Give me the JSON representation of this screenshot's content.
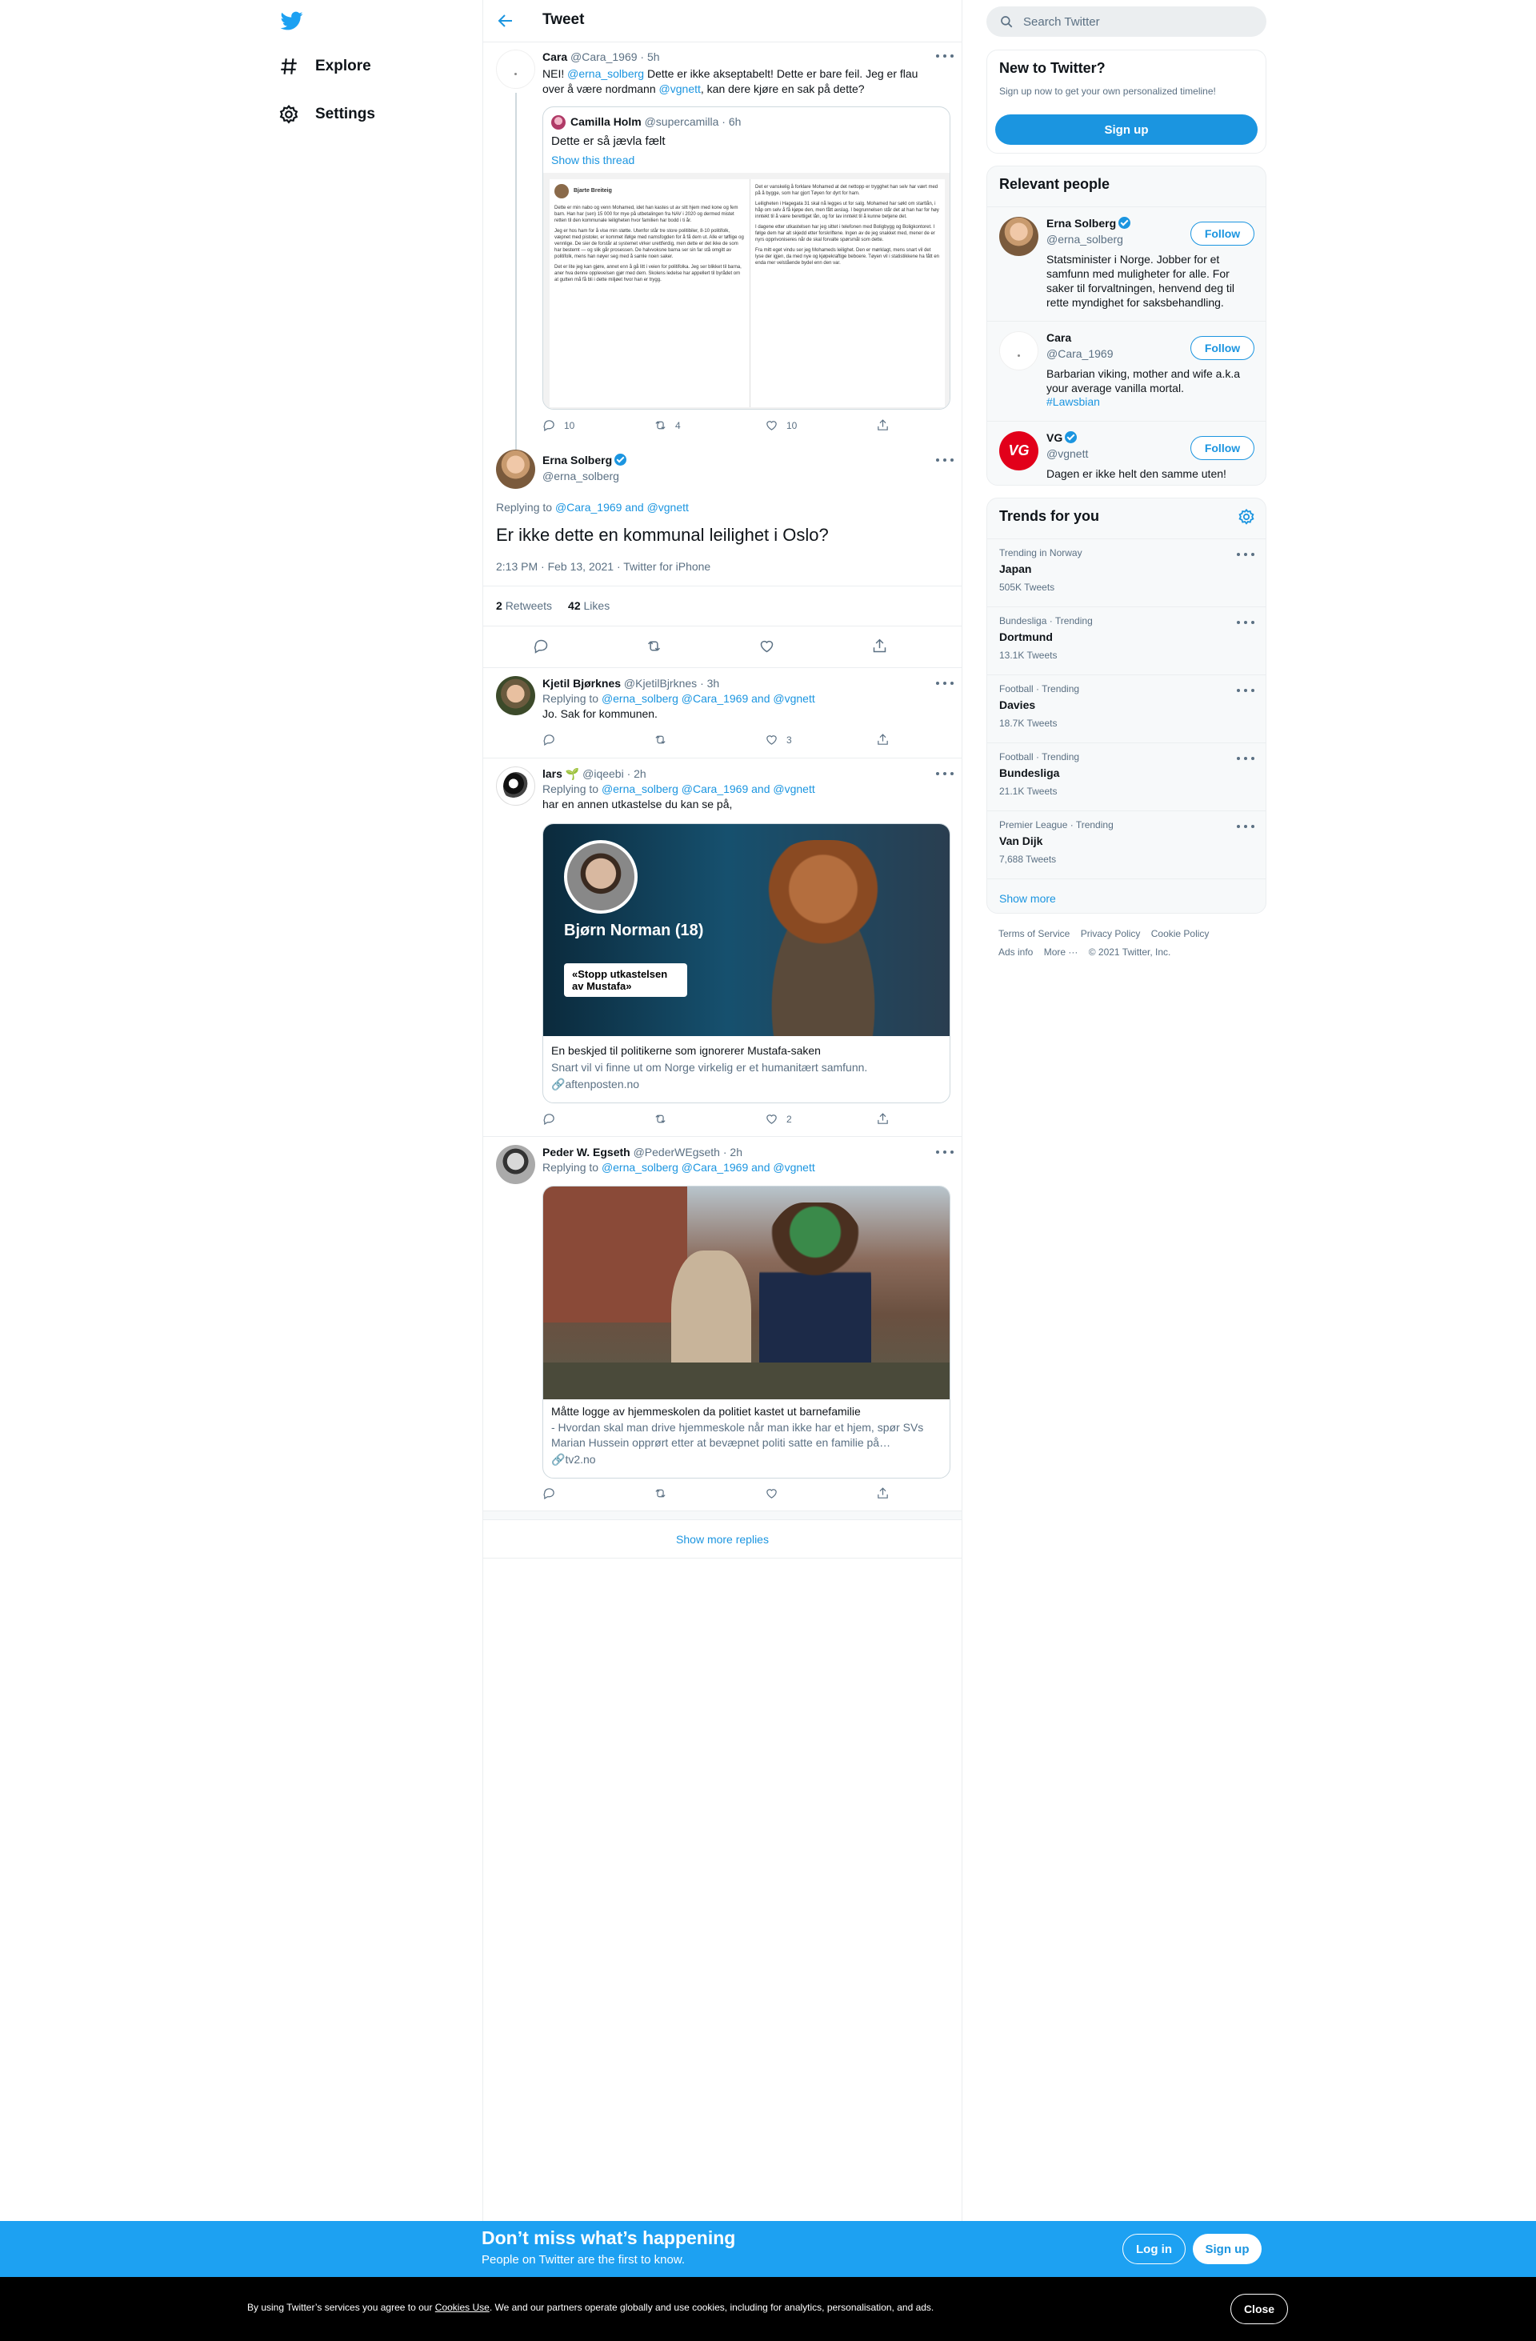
{
  "nav": {
    "explore_label": "Explore",
    "settings_label": "Settings"
  },
  "header": {
    "title": "Tweet"
  },
  "parent_tweet": {
    "name": "Cara",
    "handle": "@Cara_1969",
    "time": "· 5h",
    "text_before": "NEI! ",
    "mention1": "@erna_solberg",
    "text_middle": " Dette er ikke akseptabelt! Dette er bare feil. Jeg er flau over å være nordmann ",
    "mention2": "@vgnett",
    "text_after": ", kan dere kjøre en sak på dette?",
    "quoted": {
      "name": "Camilla Holm",
      "handle": "@supercamilla",
      "time": "· 6h",
      "text": "Dette er så jævla fælt",
      "show_thread": "Show this thread",
      "doc_author": "Bjarte Breiteig",
      "doc_left": [
        "Dette er min nabo og venn Mohamed, idet han kastes ut av sitt hjem med kone og fem barn. Han har (sen) 15 000 for mye på utbetalingen fra NAV i 2020 og dermed mistet retten til den kommunale leiligheten hvor familien har bodd i ti år.",
        "Jeg er hos ham for å vise min støtte. Utenfor står tre store politibiler, 8-10 politifolk, væpnet med pistoler, er kommet ifølge med namsfogden for å få dem ut. Alle er tøflige og vennlige. De sier de forstår at systemet virker urettferdig, men dette er det ikke de som har bestemt — og slik går prosessen. De halvvoksne barna ser sin far stå omgitt av politifolk, mens han nøyer seg med å samle noen saker.",
        "Det er lite jeg kan gjøre, annet enn å gå litt i veien for politifolka. Jeg ser blikket til barna, aner hva denne opplevelsen gjør med dem. Skolens ledelse har appellert til byrådet om at gutten må få bli i dette miljøet hvor han er trygg."
      ],
      "doc_right": [
        "Det er vanskelig å forklare Mohamed at det nettopp er trygghet han selv har vært med på å bygge, som har gjort Tøyen for dyrt for ham.",
        "Leiligheten i Hagegata 31 skal nå legges ut for salg. Mohamed har søkt om startlån, i håp om selv å få kjøpe den, men fått avslag. I begrunnelsen står det at han har for høy inntekt til å være berettiget lån, og for lav inntekt til å kunne betjene det.",
        "I dagene etter utkastelsen har jeg sittet i telefonen med Boligbygg og Boligkontoret. I følge dem har alt skjedd etter forskriftene. Ingen av de jeg snakket med, mener de er nyrs opprivoniseres når de skal forvalte spørsmål som dette.",
        "Fra mitt eget vindu ser jeg Mohameds leilighet. Den er mørklagt, mens snart vil det lyse der igjen, da med nye og kjøpekraftige beboere. Tøyen vil i statistikkene ha fått en enda mer velstående bydel enn den var."
      ]
    },
    "replies": "10",
    "retweets": "4",
    "likes": "10"
  },
  "main_tweet": {
    "name": "Erna Solberg",
    "handle": "@erna_solberg",
    "replying_label": "Replying to ",
    "replying_mentions": "@Cara_1969 and @vgnett",
    "text": "Er ikke dette en kommunal leilighet i Oslo?",
    "timestamp": "2:13 PM · Feb 13, 2021 · Twitter for iPhone",
    "retweets_count": "2",
    "retweets_label": "Retweets",
    "likes_count": "42",
    "likes_label": "Likes"
  },
  "replies": [
    {
      "name": "Kjetil Bjørknes",
      "handle": "@KjetilBjrknes",
      "time": "· 3h",
      "replying_label": "Replying to ",
      "replying_mentions": "@erna_solberg @Cara_1969 and @vgnett",
      "text": "Jo. Sak for kommunen.",
      "likes": "3"
    },
    {
      "name": "lars 🌱",
      "handle": "@iqeebi",
      "time": "· 2h",
      "replying_label": "Replying to ",
      "replying_mentions": "@erna_solberg @Cara_1969 and @vgnett",
      "text": "har en annen utkastelse du kan se på,",
      "card": {
        "overlay_name": "Bjørn Norman (18)",
        "overlay_quote": "«Stopp utkastelsen av Mustafa»",
        "title": "En beskjed til politikerne som ignorerer Mustafa-saken",
        "description": "Snart vil vi finne ut om Norge virkelig er et humanitært samfunn.",
        "domain": "aftenposten.no"
      },
      "likes": "2"
    },
    {
      "name": "Peder W. Egseth",
      "handle": "@PederWEgseth",
      "time": "· 2h",
      "replying_label": "Replying to ",
      "replying_mentions": "@erna_solberg @Cara_1969 and @vgnett",
      "card": {
        "title": "Måtte logge av hjemmeskolen da politiet kastet ut barnefamilie",
        "description": "- Hvordan skal man drive hjemmeskole når man ikke har et hjem, spør SVs Marian Hussein opprørt etter at bevæpnet politi satte en familie på…",
        "domain": "tv2.no"
      }
    }
  ],
  "show_more_replies": "Show more replies",
  "search": {
    "placeholder": "Search Twitter"
  },
  "new_to_twitter": {
    "title": "New to Twitter?",
    "subtitle": "Sign up now to get your own personalized timeline!",
    "button": "Sign up"
  },
  "relevant_people": {
    "title": "Relevant people",
    "follow_label": "Follow",
    "people": [
      {
        "name": "Erna Solberg",
        "handle": "@erna_solberg",
        "bio": "Statsminister i Norge. Jobber for et samfunn med muligheter for alle. For saker til forvaltningen, henvend deg til rette myndighet for saksbehandling."
      },
      {
        "name": "Cara",
        "handle": "@Cara_1969",
        "bio": "Barbarian viking, mother and wife a.k.a your average vanilla mortal.",
        "hashtag": "#Lawsbian"
      },
      {
        "name": "VG",
        "handle": "@vgnett",
        "bio": "Dagen er ikke helt den samme uten!"
      }
    ]
  },
  "trends": {
    "title": "Trends for you",
    "items": [
      {
        "category": "Trending in Norway",
        "name": "Japan",
        "count": "505K Tweets"
      },
      {
        "category": "Bundesliga · Trending",
        "name": "Dortmund",
        "count": "13.1K Tweets"
      },
      {
        "category": "Football · Trending",
        "name": "Davies",
        "count": "18.7K Tweets"
      },
      {
        "category": "Football · Trending",
        "name": "Bundesliga",
        "count": "21.1K Tweets"
      },
      {
        "category": "Premier League · Trending",
        "name": "Van Dijk",
        "count": "7,688 Tweets"
      }
    ],
    "show_more": "Show more"
  },
  "footer": {
    "terms": "Terms of Service",
    "privacy": "Privacy Policy",
    "cookie": "Cookie Policy",
    "ads": "Ads info",
    "more": "More ···",
    "copyright": "© 2021 Twitter, Inc."
  },
  "signup_bar": {
    "title": "Don’t miss what’s happening",
    "subtitle": "People on Twitter are the first to know.",
    "login": "Log in",
    "signup": "Sign up"
  },
  "cookie_bar": {
    "text_before": "By using Twitter’s services you agree to our ",
    "link": "Cookies Use",
    "text_after": ". We and our partners operate globally and use cookies, including for analytics, personalisation, and ads.",
    "close": "Close"
  },
  "colors": {
    "accent": "#1b95e0",
    "signup_bar": "#1da1f2",
    "vg_red": "#e2001a"
  }
}
